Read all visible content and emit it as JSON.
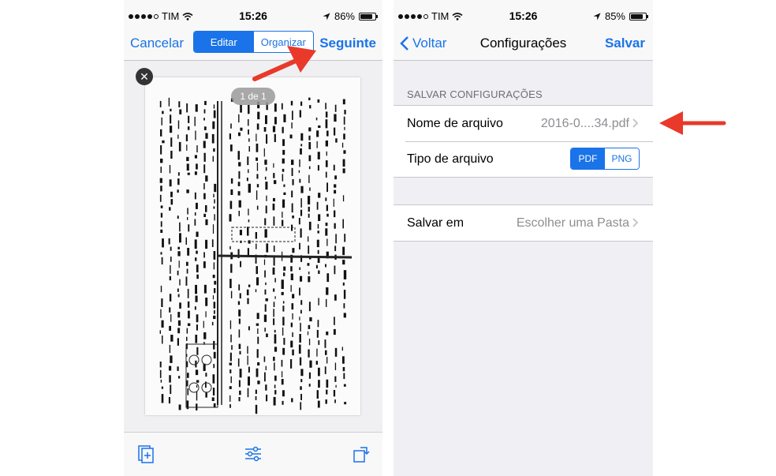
{
  "left": {
    "status": {
      "carrier": "TIM",
      "time": "15:26",
      "battery": "86%",
      "battery_level": 0.86
    },
    "nav": {
      "cancel": "Cancelar",
      "seg_edit": "Editar",
      "seg_organize": "Organizar",
      "next": "Seguinte"
    },
    "page_indicator": "1 de 1",
    "toolbar_icons": [
      "add-page-icon",
      "adjust-icon",
      "rotate-icon"
    ]
  },
  "right": {
    "status": {
      "carrier": "TIM",
      "time": "15:26",
      "battery": "85%",
      "battery_level": 0.85
    },
    "nav": {
      "back": "Voltar",
      "title": "Configurações",
      "save": "Salvar"
    },
    "section_header": "SALVAR CONFIGURAÇÕES",
    "rows": {
      "filename": {
        "label": "Nome de arquivo",
        "value": "2016-0....34.pdf"
      },
      "filetype": {
        "label": "Tipo de arquivo",
        "options": [
          "PDF",
          "PNG"
        ],
        "selected": "PDF"
      },
      "save_to": {
        "label": "Salvar em",
        "value": "Escolher uma Pasta"
      }
    }
  },
  "colors": {
    "accent": "#1a73e8",
    "annotation_arrow": "#e8392b"
  }
}
